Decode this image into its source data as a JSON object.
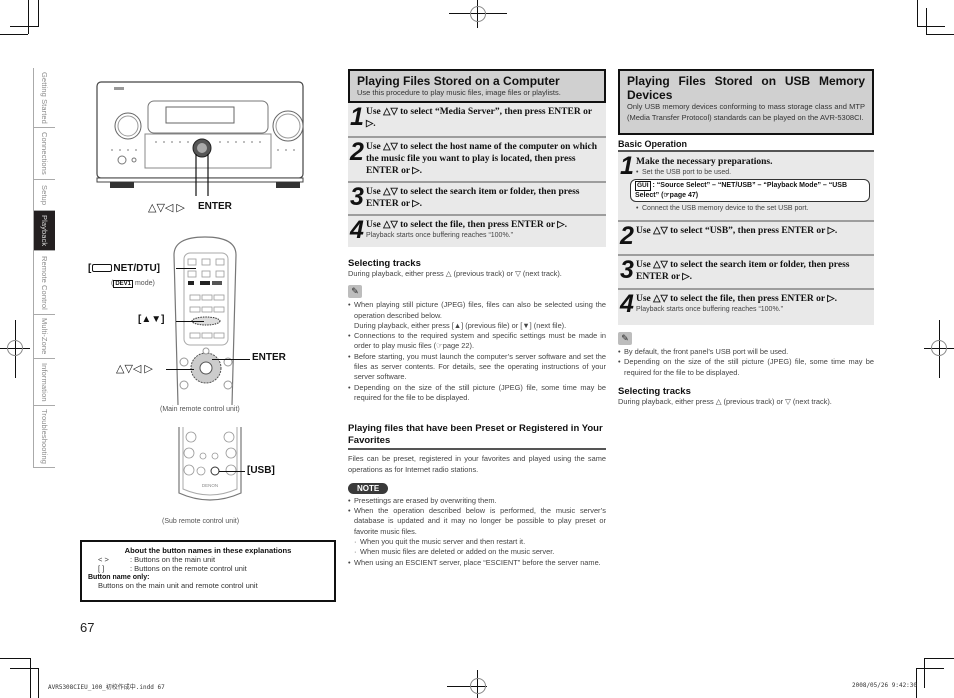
{
  "side_tabs": [
    {
      "label": "Getting Started",
      "active": false
    },
    {
      "label": "Connections",
      "active": false
    },
    {
      "label": "Setup",
      "active": false
    },
    {
      "label": "Playback",
      "active": true
    },
    {
      "label": "Remote Control",
      "active": false
    },
    {
      "label": "Multi-Zone",
      "active": false
    },
    {
      "label": "Information",
      "active": false
    },
    {
      "label": "Troubleshooting",
      "active": false
    }
  ],
  "left": {
    "main_unit_callout_arrows": "△▽◁ ▷",
    "main_unit_callout_enter": "ENTER",
    "remote_net_dtu": "NET/DTU]",
    "remote_net_dtu_bracket": "[",
    "remote_dev1_prefix": "(",
    "remote_dev1_badge": "DEV1",
    "remote_dev1_suffix": " mode)",
    "remote_updown": "[▲▼]",
    "remote_arrows": "△▽◁ ▷",
    "remote_enter": "ENTER",
    "main_remote_caption": "(Main remote control unit)",
    "sub_remote_usb": "[USB]",
    "sub_remote_brand": "DENON",
    "sub_remote_caption": "(Sub remote control unit)",
    "about_box": {
      "title": "About the button names in these explanations",
      "rows": [
        {
          "key": "<    >",
          "value": ": Buttons on the main unit"
        },
        {
          "key": "[     ]",
          "value": ": Buttons on the remote control unit"
        }
      ],
      "button_name_only_label": "Button name only:",
      "button_name_only_text": "Buttons on the main unit and remote control unit"
    },
    "page_number": "67"
  },
  "middle": {
    "header_title": "Playing Files Stored on a Computer",
    "header_sub": "Use this procedure to play music files, image files or playlists.",
    "steps": [
      {
        "num": "1",
        "text": "Use △▽ to select “Media Server”, then press ENTER or ▷."
      },
      {
        "num": "2",
        "text": "Use △▽ to select the host name of the computer on which the music file you want to play is located, then press ENTER or ▷."
      },
      {
        "num": "3",
        "text": "Use △▽ to select the search item or folder, then press ENTER or ▷."
      },
      {
        "num": "4",
        "text": "Use △▽ to select the file, then press ENTER or ▷.",
        "sub": "Playback starts once buffering reaches “100%.”"
      }
    ],
    "selecting_title": "Selecting tracks",
    "selecting_text": "During playback, either press △ (previous track) or ▽ (next track).",
    "tips": [
      "When playing still picture (JPEG) files, files can also be selected using the operation described below.",
      "Connections to the required system and specific settings must be made in order to play music files (☞page 22).",
      "Before starting, you must launch the computer’s server software and set the files as server contents. For details, see the operating instructions of your server software.",
      "Depending on the size of the still picture (JPEG) file, some time may be required for the file to be displayed."
    ],
    "tip1_extra": "During playback, either press [▲] (previous file) or [▼] (next file).",
    "preset_title": "Playing files that have been Preset or Registered in Your Favorites",
    "preset_text": "Files can be preset, registered in your favorites and played using the same operations as for Internet radio stations.",
    "note_label": "NOTE",
    "notes": [
      "Presettings are erased by overwriting them.",
      "When the operation described below is performed, the music server’s database is updated and it may no longer be possible to play preset or favorite music files."
    ],
    "note_subs": [
      "When you quit the music server and then restart it.",
      "When music files are deleted or added on the music server."
    ],
    "note_last": "When using an ESCIENT server, place “ESCIENT” before the server name."
  },
  "right": {
    "header_title": "Playing Files Stored on USB Memory Devices",
    "header_sub": "Only USB memory devices conforming to mass storage class and MTP (Media Transfer Protocol) standards can be played on the AVR-5308CI.",
    "basic_op": "Basic Operation",
    "step1_title": "Make the necessary preparations.",
    "step1_b1": "Set the USB port to be used.",
    "gui_badge": "GUI",
    "gui_text": ": “Source Select” – “NET/USB” – “Playback Mode” – “USB Select” (☞page 47)",
    "step1_b2": "Connect the USB memory device to the set USB port.",
    "steps": [
      {
        "num": "2",
        "text": "Use △▽ to select “USB”, then press ENTER or ▷."
      },
      {
        "num": "3",
        "text": "Use △▽ to select the search item or folder, then press ENTER or ▷."
      },
      {
        "num": "4",
        "text": "Use △▽ to select the file, then press ENTER or ▷.",
        "sub": "Playback starts once buffering reaches “100%.”"
      }
    ],
    "tips": [
      "By default, the front panel’s USB port will be used.",
      "Depending on the size of the still picture (JPEG) file, some time may be required for the file to be displayed."
    ],
    "selecting_title": "Selecting tracks",
    "selecting_text": "During playback, either press △ (previous track) or ▽ (next track)."
  },
  "footer": {
    "file_name": "AVR5308CIEU_100_初校作成中.indd   67",
    "timestamp": "2008/05/26   9:42:30"
  }
}
